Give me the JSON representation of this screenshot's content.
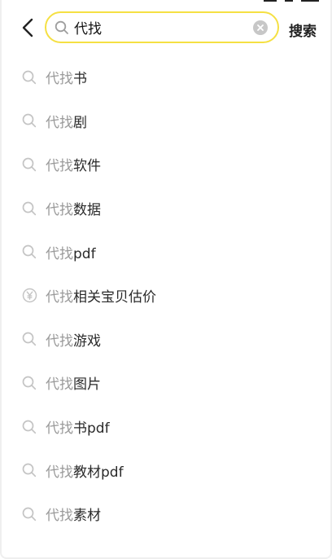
{
  "header": {
    "back_icon": "chevron-left-icon",
    "search_icon": "search-icon",
    "search_value": "代找",
    "clear_icon": "clear-circle-icon",
    "submit_label": "搜索",
    "accent_color": "#f5e043"
  },
  "suggestions": [
    {
      "icon": "search-icon",
      "match": "代找",
      "rest": "书"
    },
    {
      "icon": "search-icon",
      "match": "代找",
      "rest": "剧"
    },
    {
      "icon": "search-icon",
      "match": "代找",
      "rest": "软件"
    },
    {
      "icon": "search-icon",
      "match": "代找",
      "rest": "数据"
    },
    {
      "icon": "search-icon",
      "match": "代找",
      "rest": "pdf"
    },
    {
      "icon": "price-yen-icon",
      "match": "代找",
      "rest": "相关宝贝估价"
    },
    {
      "icon": "search-icon",
      "match": "代找",
      "rest": "游戏"
    },
    {
      "icon": "search-icon",
      "match": "代找",
      "rest": "图片"
    },
    {
      "icon": "search-icon",
      "match": "代找",
      "rest": "书pdf"
    },
    {
      "icon": "search-icon",
      "match": "代找",
      "rest": "教材pdf"
    },
    {
      "icon": "search-icon",
      "match": "代找",
      "rest": "素材"
    }
  ],
  "colors": {
    "match_text": "#9a9a9a",
    "rest_text": "#2a2a2a",
    "icon_gray": "#c4c4c4"
  }
}
